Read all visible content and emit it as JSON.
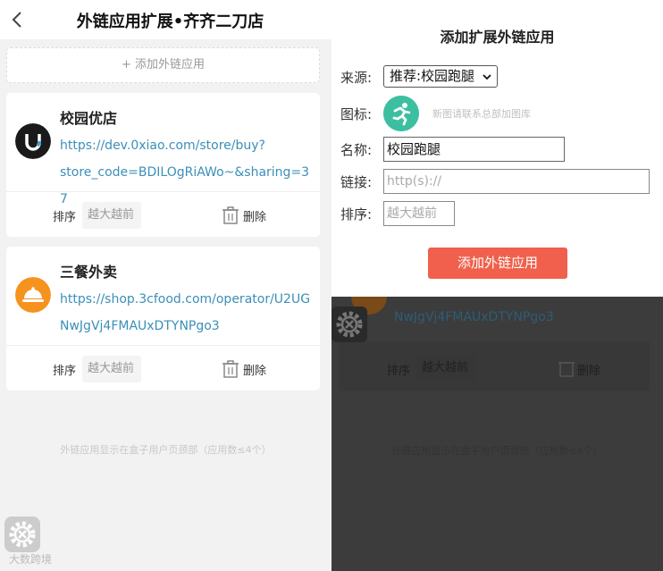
{
  "header": {
    "title": "外链应用扩展•齐齐二刀店"
  },
  "add_link_label": "+ 添加外链应用",
  "apps": [
    {
      "name": "校园优店",
      "url_line1": "https://dev.0xiao.com/store/buy?",
      "url_line2": "store_code=BDILOgRiAWo~&sharing=37",
      "sort_label": "排序",
      "sort_placeholder": "越大越前",
      "delete_label": "删除"
    },
    {
      "name": "三餐外卖",
      "url_line1": "https://shop.3cfood.com/operator/U2UG",
      "url_line2": "NwJgVj4FMAUxDTYNPgo3",
      "sort_label": "排序",
      "sort_placeholder": "越大越前",
      "delete_label": "删除"
    }
  ],
  "footnote": "外链应用显示在盒子用户页颈部（应用数≤4个）",
  "watermark": "大数跨境",
  "modal": {
    "title": "添加扩展外链应用",
    "source_label": "来源:",
    "source_value": "推荐:校园跑腿",
    "icon_label": "图标:",
    "icon_hint": "新图请联系总部加图库",
    "name_label": "名称:",
    "name_value": "校园跑腿",
    "link_label": "链接:",
    "link_placeholder": "http(s)://",
    "sort_label": "排序:",
    "sort_placeholder": "越大越前",
    "submit_label": "添加外链应用"
  },
  "colors": {
    "accent": "#f0604c",
    "link": "#3b8fb8",
    "icon_green": "#3cbfa1",
    "icon_orange": "#f6921e"
  }
}
